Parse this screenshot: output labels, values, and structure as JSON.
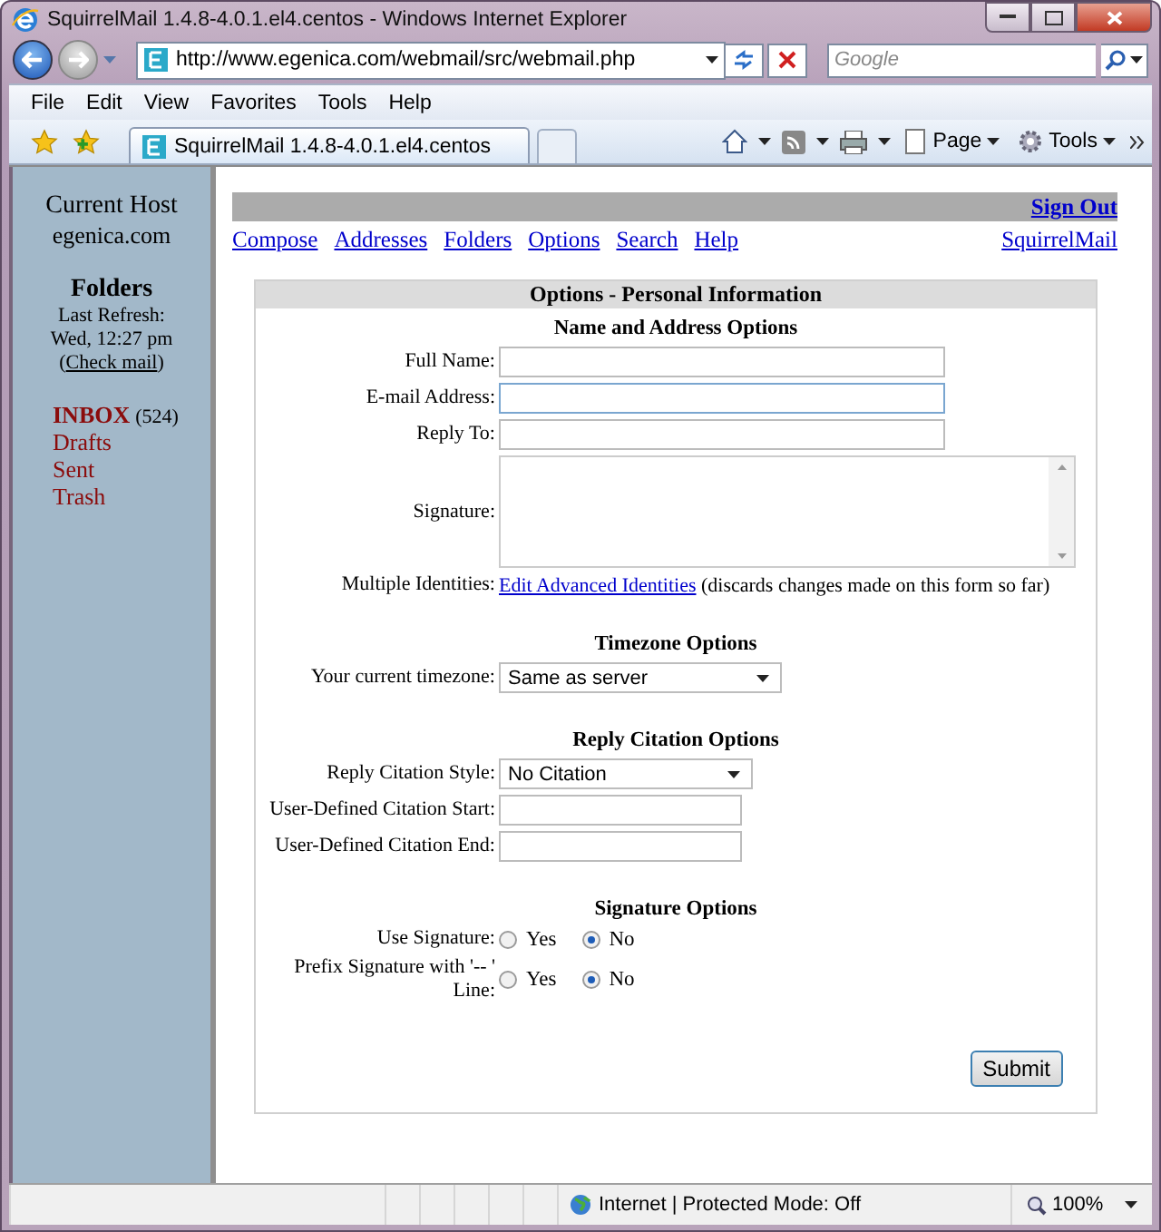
{
  "window": {
    "title": "SquirrelMail 1.4.8-4.0.1.el4.centos - Windows Internet Explorer"
  },
  "address_bar": {
    "url": "http://www.egenica.com/webmail/src/webmail.php"
  },
  "search": {
    "placeholder": "Google"
  },
  "menu": [
    "File",
    "Edit",
    "View",
    "Favorites",
    "Tools",
    "Help"
  ],
  "tabs": [
    {
      "label": "SquirrelMail 1.4.8-4.0.1.el4.centos",
      "selected": true
    }
  ],
  "command_bar": [
    "Page",
    "Tools"
  ],
  "sidebar": {
    "host_title": "Current Host",
    "host": "egenica.com",
    "folders_title": "Folders",
    "refresh_label": "Last Refresh:",
    "refresh_time": "Wed, 12:27 pm",
    "check_mail": {
      "before": "(",
      "link": "Check mail",
      "after": ")"
    },
    "folders": [
      {
        "name": "INBOX",
        "count": "(524)",
        "unread": true
      },
      {
        "name": "Drafts",
        "unread": false
      },
      {
        "name": "Sent",
        "unread": false
      },
      {
        "name": "Trash",
        "unread": false
      }
    ]
  },
  "top_bar": {
    "sign_out": "Sign Out"
  },
  "nav_links": [
    "Compose",
    "Addresses",
    "Folders",
    "Options",
    "Search",
    "Help"
  ],
  "brand_link": "SquirrelMail",
  "options": {
    "title": "Options - Personal Information",
    "sections": [
      {
        "title": "Name and Address Options",
        "rows": [
          {
            "kind": "text",
            "label": "Full Name:",
            "focused": false
          },
          {
            "kind": "text",
            "label": "E-mail Address:",
            "focused": true
          },
          {
            "kind": "text",
            "label": "Reply To:",
            "focused": false
          },
          {
            "kind": "textarea",
            "label": "Signature:"
          },
          {
            "kind": "link",
            "label": "Multiple Identities:",
            "link": "Edit Advanced Identities",
            "note": "(discards changes made on this form so far)"
          }
        ]
      },
      {
        "title": "Timezone Options",
        "rows": [
          {
            "kind": "select",
            "label": "Your current timezone:",
            "value": "Same as server"
          }
        ]
      },
      {
        "title": "Reply Citation Options",
        "rows": [
          {
            "kind": "select",
            "label": "Reply Citation Style:",
            "value": "No Citation"
          },
          {
            "kind": "short_text",
            "label": "User-Defined Citation Start:",
            "focused": false
          },
          {
            "kind": "short_text",
            "label": "User-Defined Citation End:",
            "focused": false
          }
        ]
      },
      {
        "title": "Signature Options",
        "rows": [
          {
            "kind": "radio",
            "label": "Use Signature:",
            "options": [
              {
                "label": "Yes",
                "selected": false
              },
              {
                "label": "No",
                "selected": true
              }
            ]
          },
          {
            "kind": "radio",
            "label": "Prefix Signature with '-- ' Line:",
            "options": [
              {
                "label": "Yes",
                "selected": false
              },
              {
                "label": "No",
                "selected": true
              }
            ]
          }
        ]
      }
    ],
    "submit": "Submit"
  },
  "status_bar": {
    "zone": "Internet | Protected Mode: Off",
    "zoom": "100%"
  }
}
